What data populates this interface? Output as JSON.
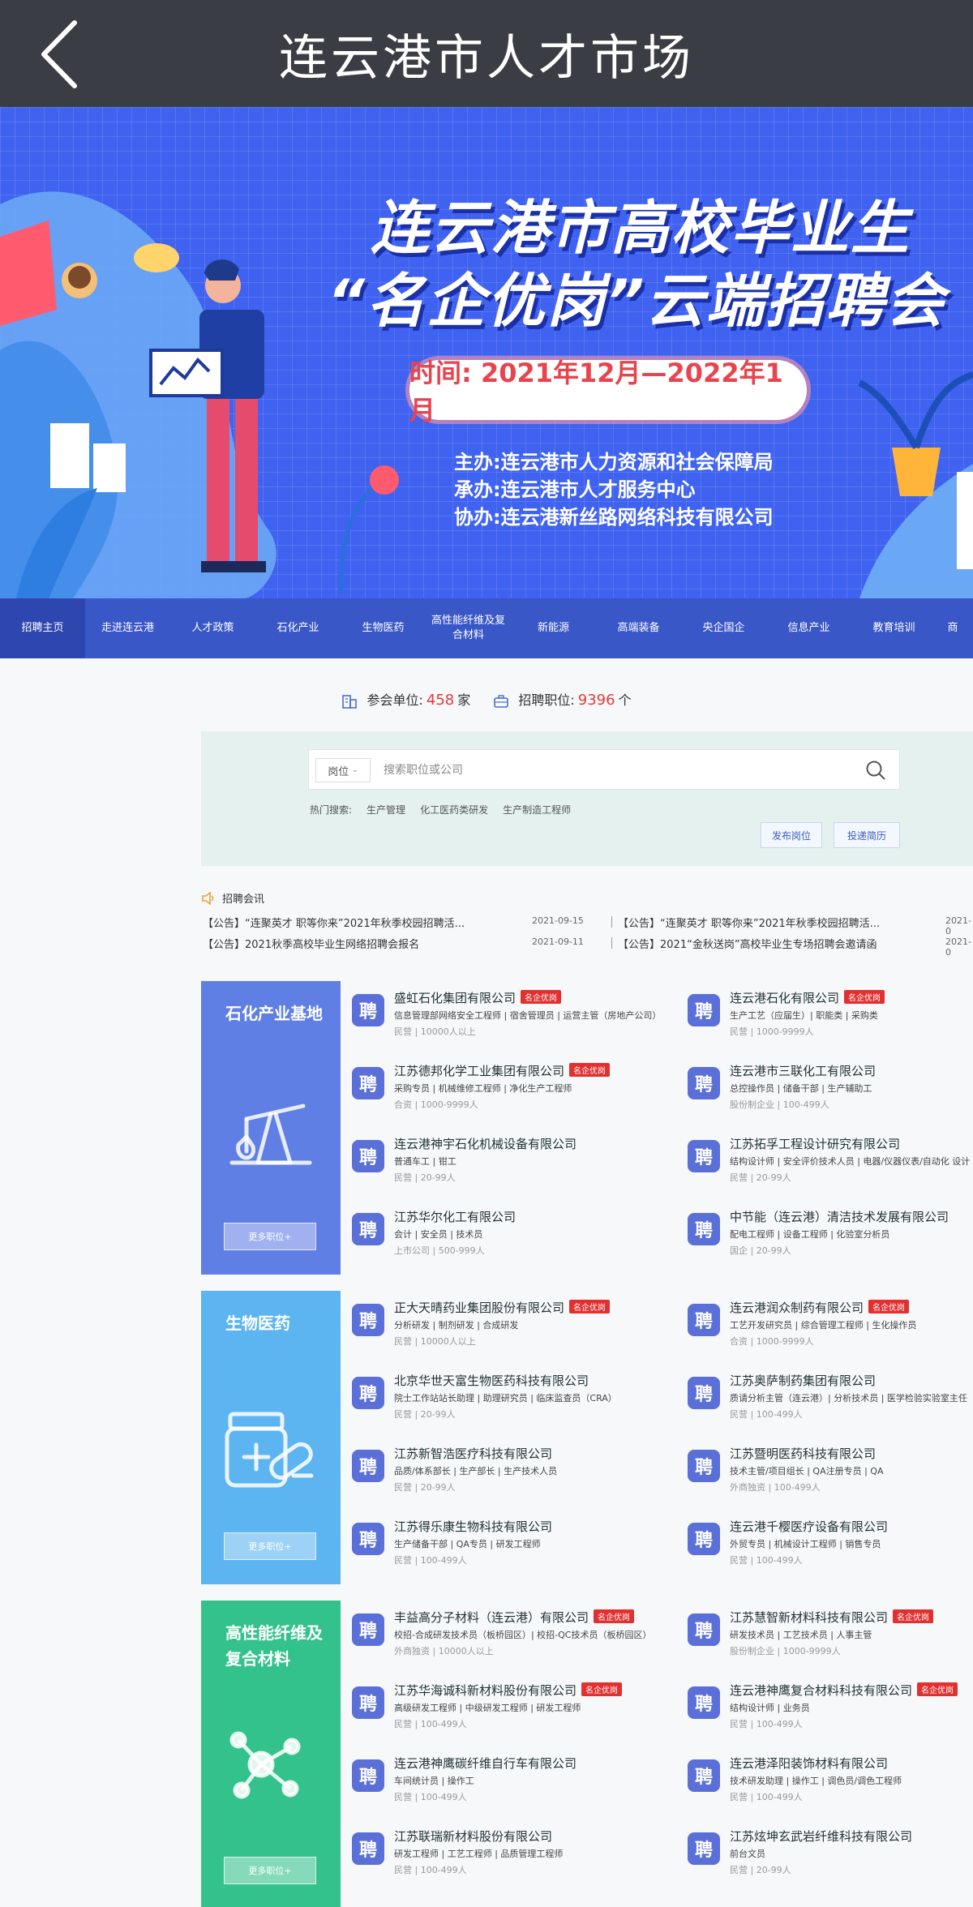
{
  "topbar": {
    "title": "连云港市人才市场"
  },
  "banner": {
    "title_line1": "连云港市高校毕业生",
    "title_line2": "“名企优岗”云端招聘会",
    "time": "时间: 2021年12月—2022年1月",
    "host": "主办:连云港市人力资源和社会保障局",
    "organizer": "承办:连云港市人才服务中心",
    "co_organizer": "协办:连云港新丝路网络科技有限公司"
  },
  "catnav": [
    "招聘主页",
    "走进连云港",
    "人才政策",
    "石化产业",
    "生物医药",
    "高性能纤维及复合材料",
    "新能源",
    "高端装备",
    "央企国企",
    "信息产业",
    "教育培训",
    "商"
  ],
  "stats": {
    "units_label": "参会单位:",
    "units": "458",
    "units_suffix": "家",
    "jobs_label": "招聘职位:",
    "jobs": "9396",
    "jobs_suffix": "个"
  },
  "search": {
    "type": "岗位",
    "placeholder": "搜索职位或公司",
    "hot_label": "热门搜索:",
    "hot": [
      "生产管理",
      "化工医药类研发",
      "生产制造工程师"
    ],
    "publish": "发布岗位",
    "resume": "投递简历"
  },
  "notices": {
    "title": "招聘会讯",
    "items": [
      {
        "text": "【公告】“连聚英才 职等你来”2021年秋季校园招聘活...",
        "date": "2021-09-15"
      },
      {
        "text": "【公告】“连聚英才 职等你来”2021年秋季校园招聘活...",
        "date": "2021-0"
      },
      {
        "text": "【公告】2021秋季高校毕业生网络招聘会报名",
        "date": "2021-09-11"
      },
      {
        "text": "【公告】2021“金秋送岗”高校毕业生专场招聘会邀请函",
        "date": "2021-0"
      }
    ]
  },
  "sections": [
    {
      "title": "石化产业基地",
      "more": "更多职位+",
      "companies": [
        {
          "name": "盛虹石化集团有限公司",
          "badge": "名企优岗",
          "jobs": "信息管理部网络安全工程师 | 宿舍管理员 | 运营主管（房地产公司）",
          "meta": "民营 | 10000人以上"
        },
        {
          "name": "连云港石化有限公司",
          "badge": "名企优岗",
          "jobs": "生产工艺（应届生）| 职能类 | 采购类",
          "meta": "民营 | 1000-9999人"
        },
        {
          "name": "江苏德邦化学工业集团有限公司",
          "badge": "名企优岗",
          "jobs": "采购专员 | 机械维修工程师 | 净化生产工程师",
          "meta": "合资 | 1000-9999人"
        },
        {
          "name": "连云港市三联化工有限公司",
          "badge": "",
          "jobs": "总控操作员 | 储备干部 | 生产辅助工",
          "meta": "股份制企业 | 100-499人"
        },
        {
          "name": "连云港神宇石化机械设备有限公司",
          "badge": "",
          "jobs": "普通车工 | 钳工",
          "meta": "民营 | 20-99人"
        },
        {
          "name": "江苏拓孚工程设计研究有限公司",
          "badge": "",
          "jobs": "结构设计师 | 安全评价技术人员 | 电器/仪器仪表/自动化 设计",
          "meta": "民营 | 20-99人"
        },
        {
          "name": "江苏华尔化工有限公司",
          "badge": "",
          "jobs": "会计 | 安全员 | 技术员",
          "meta": "上市公司 | 500-999人"
        },
        {
          "name": "中节能（连云港）清洁技术发展有限公司",
          "badge": "",
          "jobs": "配电工程师 | 设备工程师 | 化验室分析员",
          "meta": "国企 | 20-99人"
        }
      ]
    },
    {
      "title": "生物医药",
      "more": "更多职位+",
      "companies": [
        {
          "name": "正大天晴药业集团股份有限公司",
          "badge": "名企优岗",
          "jobs": "分析研发 | 制剂研发 | 合成研发",
          "meta": "民营 | 10000人以上"
        },
        {
          "name": "连云港润众制药有限公司",
          "badge": "名企优岗",
          "jobs": "工艺开发研究员 | 综合管理工程师 | 生化操作员",
          "meta": "合资 | 1000-9999人"
        },
        {
          "name": "北京华世天富生物医药科技有限公司",
          "badge": "",
          "jobs": "院士工作站站长助理 | 助理研究员 | 临床监查员（CRA）",
          "meta": "民营 | 20-99人"
        },
        {
          "name": "江苏奥萨制药集团有限公司",
          "badge": "",
          "jobs": "质请分析主管（连云港）| 分析技术员 | 医学检验实验室主任",
          "meta": "民营 | 100-499人"
        },
        {
          "name": "江苏新智浩医疗科技有限公司",
          "badge": "",
          "jobs": "品质/体系部长 | 生产部长 | 生产技术人员",
          "meta": "民营 | 20-99人"
        },
        {
          "name": "江苏暨明医药科技有限公司",
          "badge": "",
          "jobs": "技术主管/项目组长 | QA注册专员 | QA",
          "meta": "外商独资 | 100-499人"
        },
        {
          "name": "江苏得乐康生物科技有限公司",
          "badge": "",
          "jobs": "生产储备干部 | QA专员 | 研发工程师",
          "meta": "民营 | 100-499人"
        },
        {
          "name": "连云港千樱医疗设备有限公司",
          "badge": "",
          "jobs": "外贸专员 | 机械设计工程师 | 销售专员",
          "meta": "民营 | 100-499人"
        }
      ]
    },
    {
      "title": "高性能纤维及复合材料",
      "more": "更多职位+",
      "companies": [
        {
          "name": "丰益高分子材料（连云港）有限公司",
          "badge": "名企优岗",
          "jobs": "校招-合成研发技术员（板桥园区）| 校招-QC技术员（板桥园区）",
          "meta": "外商独资 | 10000人以上"
        },
        {
          "name": "江苏慧智新材料科技有限公司",
          "badge": "名企优岗",
          "jobs": "研发技术员 | 工艺技术员 | 人事主管",
          "meta": "股份制企业 | 1000-9999人"
        },
        {
          "name": "江苏华海诚科新材料股份有限公司",
          "badge": "名企优岗",
          "jobs": "高级研发工程师 | 中级研发工程师 | 研发工程师",
          "meta": "民营 | 100-499人"
        },
        {
          "name": "连云港神鹰复合材料科技有限公司",
          "badge": "名企优岗",
          "jobs": "结构设计师 | 业务员",
          "meta": "民营 | 100-499人"
        },
        {
          "name": "连云港神鹰碳纤维自行车有限公司",
          "badge": "",
          "jobs": "车间统计员 | 操作工",
          "meta": "民营 | 100-499人"
        },
        {
          "name": "连云港泽阳装饰材料有限公司",
          "badge": "",
          "jobs": "技术研发助理 | 操作工 | 调色员/调色工程师",
          "meta": "民营 | 100-499人"
        },
        {
          "name": "江苏联瑞新材料股份有限公司",
          "badge": "",
          "jobs": "研发工程师 | 工艺工程师 | 品质管理工程师",
          "meta": "民营 | 100-499人"
        },
        {
          "name": "江苏炫坤玄武岩纤维科技有限公司",
          "badge": "",
          "jobs": "前台文员",
          "meta": "民营 | 20-99人"
        }
      ]
    }
  ],
  "logo_char": "聘",
  "colors": {
    "sec1": "#5f7fe4",
    "sec2": "#5cb4f0",
    "sec3": "#33c28c",
    "logo": "#5a70d8",
    "badge": "#e23030",
    "nav": "#3a57c8"
  }
}
